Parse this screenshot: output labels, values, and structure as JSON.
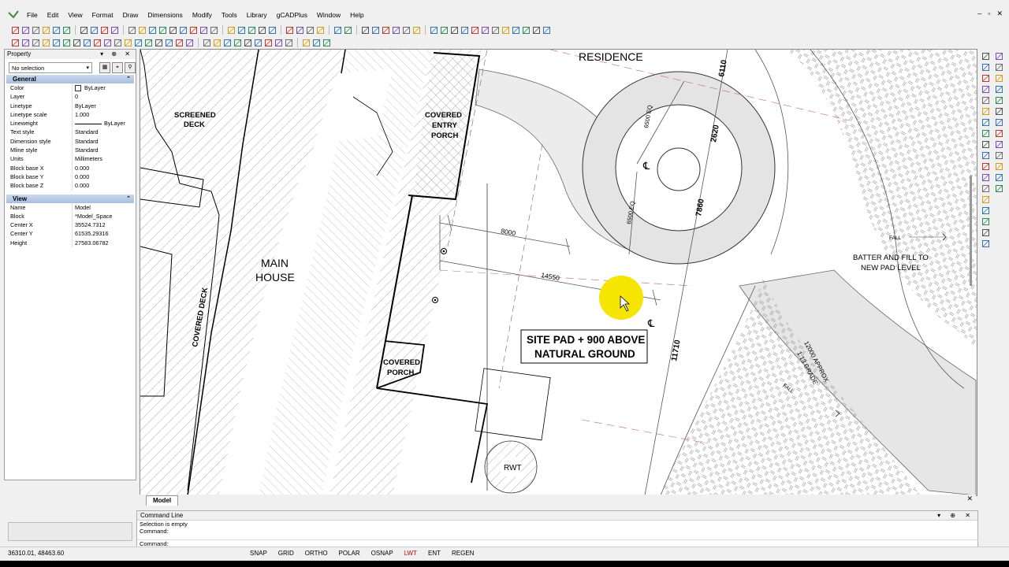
{
  "menu": [
    "File",
    "Edit",
    "View",
    "Format",
    "Draw",
    "Dimensions",
    "Modify",
    "Tools",
    "Library",
    "gCADPlus",
    "Window",
    "Help"
  ],
  "property_panel": {
    "title": "Property",
    "selection": "No selection",
    "general": {
      "title": "General",
      "rows": [
        {
          "k": "Color",
          "v": "ByLayer"
        },
        {
          "k": "Layer",
          "v": "0"
        },
        {
          "k": "Linetype",
          "v": "ByLayer"
        },
        {
          "k": "Linetype scale",
          "v": "1.000"
        },
        {
          "k": "Lineweight",
          "v": "ByLayer"
        },
        {
          "k": "Text style",
          "v": "Standard"
        },
        {
          "k": "Dimension style",
          "v": "Standard"
        },
        {
          "k": "Mline style",
          "v": "Standard"
        },
        {
          "k": "Units",
          "v": "Millimeters"
        },
        {
          "k": "Block base X",
          "v": "0.000"
        },
        {
          "k": "Block base Y",
          "v": "0.000"
        },
        {
          "k": "Block base Z",
          "v": "0.000"
        }
      ]
    },
    "view": {
      "title": "View",
      "rows": [
        {
          "k": "Name",
          "v": "Model"
        },
        {
          "k": "Block",
          "v": "*Model_Space"
        },
        {
          "k": "Center X",
          "v": "35524.7312"
        },
        {
          "k": "Center Y",
          "v": "61535.29316"
        },
        {
          "k": "Height",
          "v": "27583.06782"
        }
      ]
    }
  },
  "drawing": {
    "labels": {
      "residence": "RESIDENCE",
      "screened_deck_1": "SCREENED",
      "screened_deck_2": "DECK",
      "covered_entry_1": "COVERED",
      "covered_entry_2": "ENTRY",
      "covered_entry_3": "PORCH",
      "main_house_1": "MAIN",
      "main_house_2": "HOUSE",
      "covered_deck": "COVERED DECK",
      "covered_porch_1": "COVERED",
      "covered_porch_2": "PORCH",
      "rwt": "RWT",
      "site_pad_1": "SITE PAD + 900 ABOVE",
      "site_pad_2": "NATURAL GROUND",
      "batter_1": "BATTER AND FILL TO",
      "batter_2": "NEW PAD LEVEL",
      "grade_1": "12000 APPROX",
      "grade_2": "1:13 GRADE",
      "fall_1": "FALL",
      "fall_2": "FALL",
      "cl_1": "℄",
      "cl_2": "℄"
    },
    "dimensions": {
      "d8000": "8000",
      "d14550": "14550",
      "d6110": "6110",
      "d2620": "2620",
      "d7860": "7860",
      "d11710": "11710",
      "d6500eq_1": "6500 EQ",
      "d6500eq_2": "6500 EQ"
    }
  },
  "tabs": {
    "model": "Model"
  },
  "command": {
    "title": "Command Line",
    "lines": [
      "Selection is empty",
      "Command:"
    ],
    "prompt": "Command:"
  },
  "status": {
    "coords": "36310.01, 48463.60",
    "buttons": [
      {
        "label": "SNAP",
        "on": false
      },
      {
        "label": "GRID",
        "on": false
      },
      {
        "label": "ORTHO",
        "on": false
      },
      {
        "label": "POLAR",
        "on": false
      },
      {
        "label": "OSNAP",
        "on": false
      },
      {
        "label": "LWT",
        "on": true
      },
      {
        "label": "ENT",
        "on": false
      },
      {
        "label": "REGEN",
        "on": false
      }
    ]
  },
  "colors": {
    "panel_header": "#a9bedd",
    "cursor_highlight": "#f5e500",
    "lwt_on": "#d00000"
  }
}
